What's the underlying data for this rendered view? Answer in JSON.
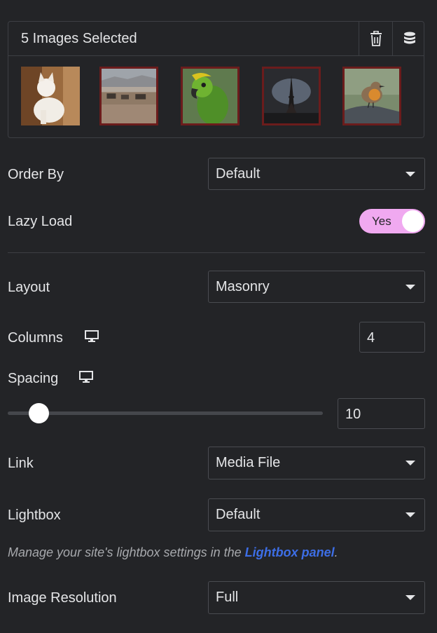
{
  "gallery": {
    "title": "5 Images Selected",
    "delete_icon": "trash-icon",
    "bulk_icon": "database-stack-icon",
    "thumbnails": [
      {
        "subject": "cat",
        "selected": false
      },
      {
        "subject": "zebras",
        "selected": true
      },
      {
        "subject": "parrot",
        "selected": true
      },
      {
        "subject": "eiffel-tower",
        "selected": true
      },
      {
        "subject": "robin",
        "selected": true
      }
    ]
  },
  "order_by": {
    "label": "Order By",
    "value": "Default"
  },
  "lazy_load": {
    "label": "Lazy Load",
    "value": "Yes",
    "on": true
  },
  "layout": {
    "label": "Layout",
    "value": "Masonry"
  },
  "columns": {
    "label": "Columns",
    "value": "4",
    "device_icon": "desktop-icon"
  },
  "spacing": {
    "label": "Spacing",
    "value": "10",
    "device_icon": "desktop-icon",
    "slider_fraction": 0.1
  },
  "link": {
    "label": "Link",
    "value": "Media File"
  },
  "lightbox": {
    "label": "Lightbox",
    "value": "Default"
  },
  "help": {
    "prefix": "Manage your site's lightbox settings in the ",
    "link_text": "Lightbox panel",
    "suffix": "."
  },
  "image_resolution": {
    "label": "Image Resolution",
    "value": "Full"
  },
  "colors": {
    "background": "#232427",
    "border": "#3d3f44",
    "toggle_on": "#f0a9f0",
    "link": "#3d6ee6",
    "selected_frame": "#6b1c1c"
  }
}
